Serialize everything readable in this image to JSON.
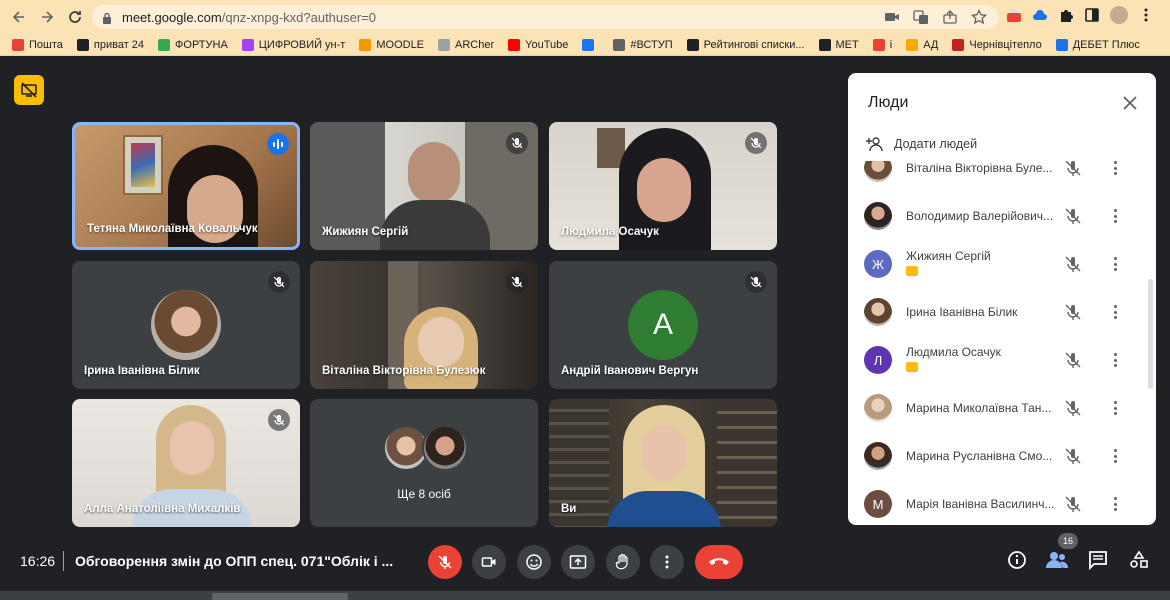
{
  "browser": {
    "url_host": "meet.google.com",
    "url_path": "/qnz-xnpg-kxd?authuser=0"
  },
  "bookmarks": [
    {
      "label": "Пошта",
      "color": "#ea4335"
    },
    {
      "label": "приват 24",
      "color": "#202124"
    },
    {
      "label": "ФОРТУНА",
      "color": "#34a853"
    },
    {
      "label": "ЦИФРОВИЙ ун-т",
      "color": "#a142f4"
    },
    {
      "label": "MOODLE",
      "color": "#f29900"
    },
    {
      "label": "ARCher",
      "color": "#9aa0a6"
    },
    {
      "label": "YouTube",
      "color": "#ff0000"
    },
    {
      "label": "",
      "color": "#1877f2"
    },
    {
      "label": "#ВСТУП",
      "color": "#5f6368"
    },
    {
      "label": "Рейтингові списки...",
      "color": "#202124"
    },
    {
      "label": "МЕТ",
      "color": "#202124"
    },
    {
      "label": "і",
      "color": "#ea4335"
    },
    {
      "label": "АД",
      "color": "#f9ab00"
    },
    {
      "label": "Чернівцітепло",
      "color": "#c5221f"
    },
    {
      "label": "ДЕБЕТ Плюс",
      "color": "#1a73e8"
    }
  ],
  "tiles": [
    {
      "name": "Тетяна Миколаївна Ковальчук"
    },
    {
      "name": "Жижиян Сергій"
    },
    {
      "name": "Людмила Осачук"
    },
    {
      "name": "Ірина Іванівна Білик"
    },
    {
      "name": "Віталіна Вікторівна Булезюк"
    },
    {
      "name": "Андрій Іванович Вергун",
      "letter": "A"
    },
    {
      "name": "Алла Анатоліївна Михалків"
    },
    {
      "name": "Ще 8 осіб"
    },
    {
      "name": "Ви"
    }
  ],
  "panel": {
    "title": "Люди",
    "add_people": "Додати людей",
    "participants": [
      {
        "name": "Віталіна Вікторівна Буле..."
      },
      {
        "name": "Володимир Валерійович..."
      },
      {
        "name": "Жижиян Сергій",
        "letter": "Ж",
        "color": "#5c6bc0",
        "presenting": true
      },
      {
        "name": "Ірина Іванівна Білик"
      },
      {
        "name": "Людмила Осачук",
        "letter": "Л",
        "color": "#5e35b1",
        "presenting": true
      },
      {
        "name": "Марина Миколаївна Тан..."
      },
      {
        "name": "Марина Русланівна Смо..."
      },
      {
        "name": "Марія Іванівна Василинч...",
        "letter": "М",
        "color": "#6d4c41"
      }
    ]
  },
  "bottom": {
    "time": "16:26",
    "separator": "|",
    "meeting_title": "Обговорення змін до ОПП спец. 071\"Облік і ...",
    "people_count": "16"
  }
}
